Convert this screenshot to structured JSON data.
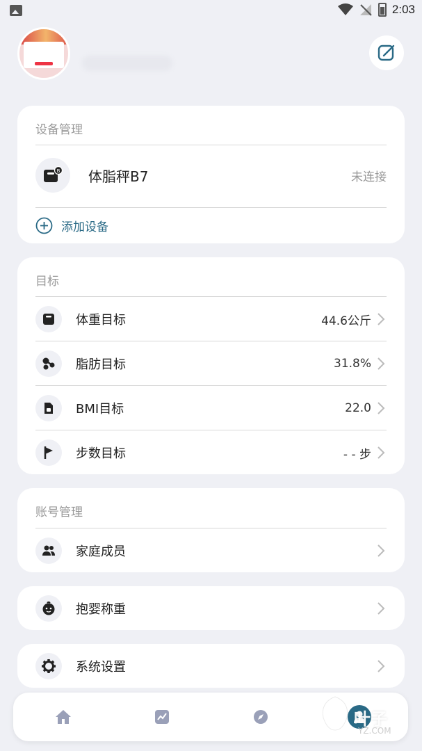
{
  "status_bar": {
    "time": "2:03"
  },
  "device_card": {
    "title": "设备管理",
    "device": {
      "name": "体脂秤B7",
      "status": "未连接"
    },
    "add_label": "添加设备"
  },
  "goal_card": {
    "title": "目标",
    "items": [
      {
        "label": "体重目标",
        "value": "44.6公斤",
        "icon": "scale-icon"
      },
      {
        "label": "脂肪目标",
        "value": "31.8%",
        "icon": "fat-icon"
      },
      {
        "label": "BMI目标",
        "value": "22.0",
        "icon": "bmi-icon"
      },
      {
        "label": "步数目标",
        "value": "- - 步",
        "icon": "flag-icon"
      }
    ]
  },
  "account_card": {
    "title": "账号管理",
    "items": [
      {
        "label": "家庭成员",
        "icon": "family-icon"
      }
    ]
  },
  "baby_card": {
    "label": "抱婴称重",
    "icon": "baby-icon"
  },
  "settings_card": {
    "label": "系统设置",
    "icon": "gear-icon"
  },
  "bottom_nav": {
    "items": [
      {
        "icon": "home-icon"
      },
      {
        "icon": "chart-icon"
      },
      {
        "icon": "compass-icon"
      },
      {
        "icon": "profile-icon",
        "active": true
      }
    ]
  },
  "watermark": {
    "text": "叶子",
    "sub": "YZ.COM"
  },
  "colors": {
    "accent": "#2a6a86",
    "background": "#eff0f5",
    "muted": "#999999"
  }
}
